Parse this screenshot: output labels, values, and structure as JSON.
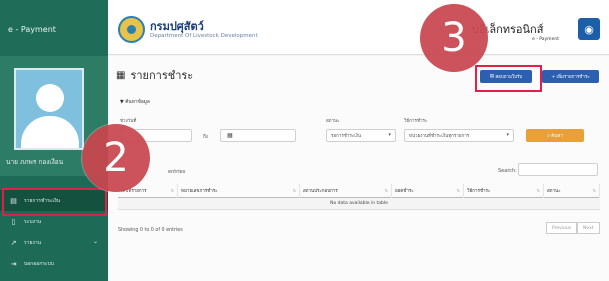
{
  "brand": {
    "title": "e - Payment"
  },
  "user": {
    "name": "นาย ภภพร กองเงือน"
  },
  "menu": {
    "items": [
      {
        "label": "รายการชำระเงิน",
        "icon": "list-icon"
      },
      {
        "label": "ระบงาน",
        "icon": "document-icon"
      },
      {
        "label": "รายงาน",
        "icon": "chart-icon"
      },
      {
        "label": "บอกออกระบบ",
        "icon": "logout-icon"
      }
    ]
  },
  "header": {
    "dept_th": "กรมปศุสัตว์",
    "dept_en": "Department Of Livestock Development",
    "system_th": "บอิเล็กทรอนิกส์",
    "system_en": "e - Payment"
  },
  "page": {
    "title": "รายการชำระ",
    "print_button": "สอบถามใบรับ",
    "add_button": "+ เพิ่มรายการชำระ"
  },
  "filter": {
    "toggle": "▼ ค้นหาข้อมูล",
    "date_label": "ช่วงวันที่",
    "to_label": "ถึง",
    "status_label": "สถานะ",
    "status_value": "รอการชำระเงิน",
    "method_label": "วิธีการชำระ",
    "method_value": "หน่วยงานที่ชำระเงินทุกรายการ",
    "search_button": "ค้นหา"
  },
  "table": {
    "entries_label": "entries",
    "search_label": "Search:",
    "columns": [
      "เลขที่รายการ",
      "หมายเลขการชำระ",
      "สถานประกอบการ",
      "ยอดชำระ",
      "วิธีการชำระ",
      "สถานะ"
    ],
    "empty": "No data available in table",
    "showing": "Showing 0 to 0 of 0 entries",
    "prev": "Previous",
    "next": "Next"
  },
  "annotations": {
    "step_a": "2",
    "step_b": "3"
  }
}
